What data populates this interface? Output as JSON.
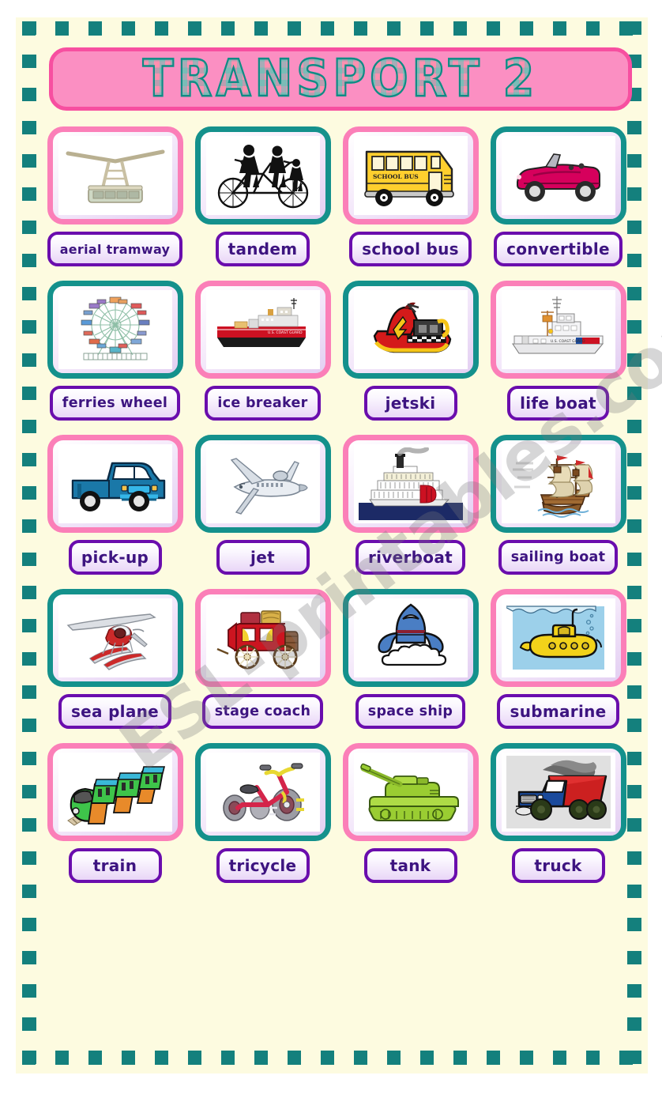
{
  "page": {
    "title": "TRANSPORT 2",
    "watermark": "ESL-printables.com",
    "colors": {
      "background": "#fdfbe0",
      "frame_dash": "#14807d",
      "banner_fill": "#fb8fc2",
      "banner_border": "#f74fa0",
      "card_border_pink": "#fb7fb8",
      "card_border_teal": "#14918c",
      "label_border": "#6a0dad",
      "label_text": "#3d1480"
    }
  },
  "rows": [
    {
      "cells": [
        {
          "label": "aerial tramway",
          "icon": "aerial-tramway-icon",
          "border": "pink"
        },
        {
          "label": "tandem",
          "icon": "tandem-bicycle-icon",
          "border": "teal"
        },
        {
          "label": "school bus",
          "icon": "school-bus-icon",
          "border": "pink"
        },
        {
          "label": "convertible",
          "icon": "convertible-car-icon",
          "border": "teal"
        }
      ]
    },
    {
      "cells": [
        {
          "label": "ferries wheel",
          "icon": "ferris-wheel-icon",
          "border": "teal"
        },
        {
          "label": "ice breaker",
          "icon": "ice-breaker-ship-icon",
          "border": "pink"
        },
        {
          "label": "jetski",
          "icon": "jetski-icon",
          "border": "teal"
        },
        {
          "label": "life boat",
          "icon": "life-boat-icon",
          "border": "pink"
        }
      ]
    },
    {
      "cells": [
        {
          "label": "pick-up",
          "icon": "pickup-truck-icon",
          "border": "pink"
        },
        {
          "label": "jet",
          "icon": "jet-plane-icon",
          "border": "teal"
        },
        {
          "label": "riverboat",
          "icon": "riverboat-icon",
          "border": "pink"
        },
        {
          "label": "sailing boat",
          "icon": "sailing-ship-icon",
          "border": "teal"
        }
      ]
    },
    {
      "cells": [
        {
          "label": "sea plane",
          "icon": "sea-plane-icon",
          "border": "teal"
        },
        {
          "label": "stage coach",
          "icon": "stage-coach-icon",
          "border": "pink"
        },
        {
          "label": "space ship",
          "icon": "space-ship-icon",
          "border": "teal"
        },
        {
          "label": "submarine",
          "icon": "submarine-icon",
          "border": "pink"
        }
      ]
    },
    {
      "cells": [
        {
          "label": "train",
          "icon": "train-icon",
          "border": "pink"
        },
        {
          "label": "tricycle",
          "icon": "tricycle-icon",
          "border": "teal"
        },
        {
          "label": "tank",
          "icon": "tank-icon",
          "border": "pink"
        },
        {
          "label": "truck",
          "icon": "dump-truck-icon",
          "border": "teal"
        }
      ]
    }
  ]
}
